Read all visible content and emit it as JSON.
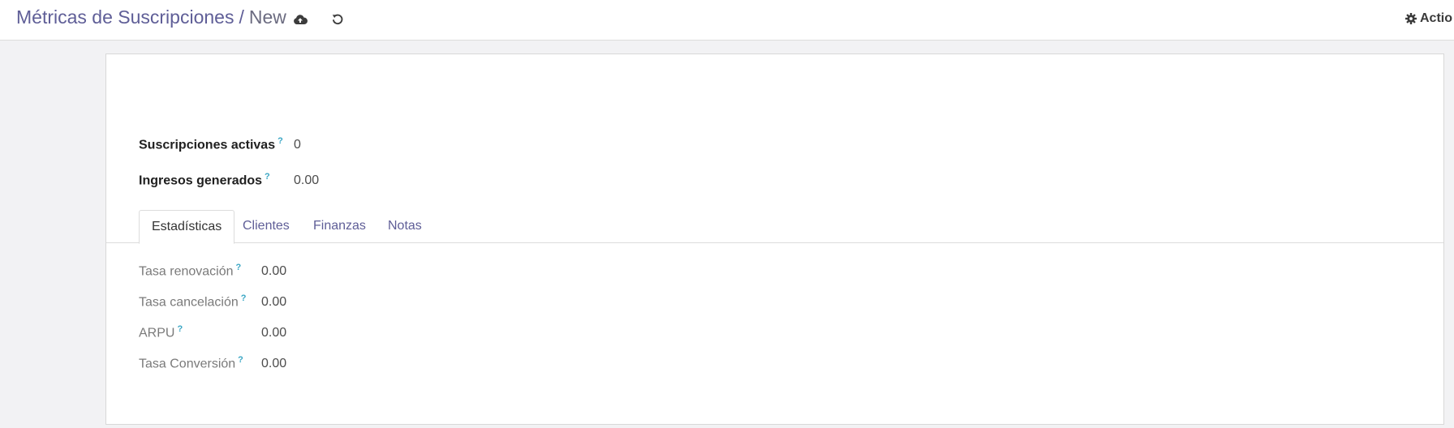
{
  "header": {
    "breadcrumb_parent": "Métricas de Suscripciones",
    "breadcrumb_separator": "/",
    "breadcrumb_current": "New",
    "save_icon": "cloud-upload-icon",
    "discard_icon": "undo-icon",
    "actions_icon": "gear-icon",
    "actions_label": "Actio"
  },
  "form": {
    "help_mark": "?",
    "fields": [
      {
        "label": "Suscripciones activas",
        "value": "0"
      },
      {
        "label": "Ingresos generados",
        "value": "0.00"
      }
    ],
    "tabs": [
      "Estadísticas",
      "Clientes",
      "Finanzas",
      "Notas"
    ],
    "active_tab": "Estadísticas",
    "stats": [
      {
        "label": "Tasa renovación",
        "value": "0.00"
      },
      {
        "label": "Tasa cancelación",
        "value": "0.00"
      },
      {
        "label": "ARPU",
        "value": "0.00"
      },
      {
        "label": "Tasa Conversión",
        "value": "0.00"
      }
    ]
  },
  "colors": {
    "link": "#5f5e97",
    "help": "#3aa6c4",
    "background": "#f2f2f4"
  }
}
